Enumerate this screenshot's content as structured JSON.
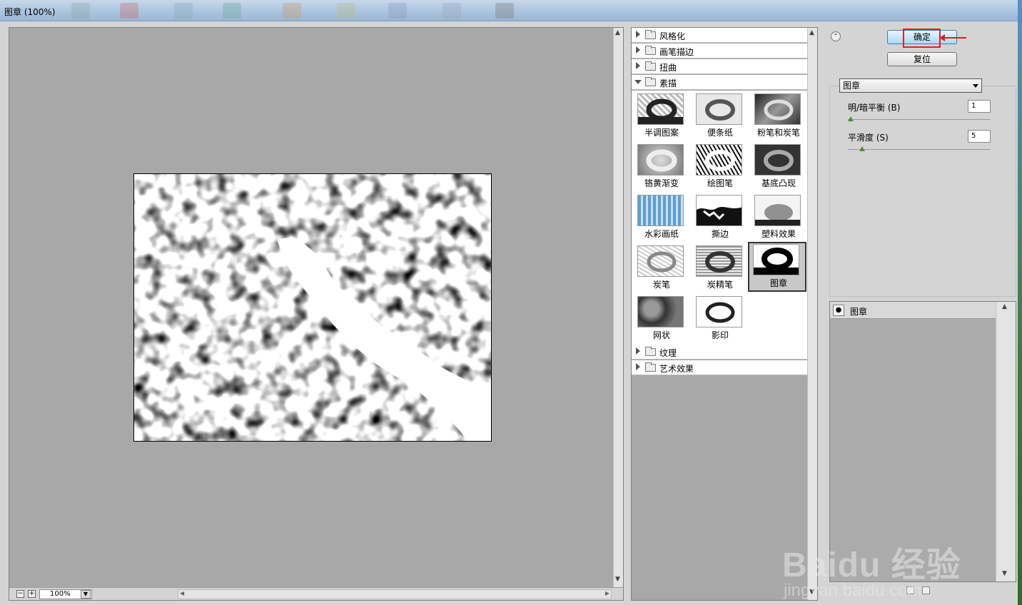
{
  "window": {
    "title": "图章 (100%)"
  },
  "preview": {
    "zoom": "100%",
    "zoom_out": "−",
    "zoom_in": "+",
    "scroll_up": "▲",
    "scroll_down": "▼",
    "scroll_left": "◀",
    "scroll_right": "▶"
  },
  "filters": {
    "categories_top": [
      {
        "label": "风格化"
      },
      {
        "label": "画笔描边"
      },
      {
        "label": "扭曲"
      }
    ],
    "open_category": {
      "label": "素描"
    },
    "gallery": [
      {
        "label": "半调图案"
      },
      {
        "label": "便条纸"
      },
      {
        "label": "粉笔和炭笔"
      },
      {
        "label": "铬黄渐变"
      },
      {
        "label": "绘图笔"
      },
      {
        "label": "基底凸现"
      },
      {
        "label": "水彩画纸"
      },
      {
        "label": "撕边"
      },
      {
        "label": "塑料效果"
      },
      {
        "label": "炭笔"
      },
      {
        "label": "炭精笔"
      },
      {
        "label": "图章"
      },
      {
        "label": "网状"
      },
      {
        "label": "影印"
      }
    ],
    "selected": "图章",
    "categories_bottom": [
      {
        "label": "纹理"
      },
      {
        "label": "艺术效果"
      }
    ]
  },
  "settings": {
    "ok_label": "确定",
    "reset_label": "复位",
    "filter_select": "图章",
    "params": [
      {
        "label": "明/暗平衡 (B)",
        "value": "1",
        "slider": 0.02
      },
      {
        "label": "平滑度 (S)",
        "value": "5",
        "slider": 0.1
      }
    ]
  },
  "layers": {
    "items": [
      {
        "name": "图章"
      }
    ]
  },
  "watermark": {
    "brand": "Baidu 经验",
    "url": "jingyan.baidu.com"
  },
  "colors": {
    "highlight": "#e02020",
    "ok_button": "#a7d9f5"
  }
}
